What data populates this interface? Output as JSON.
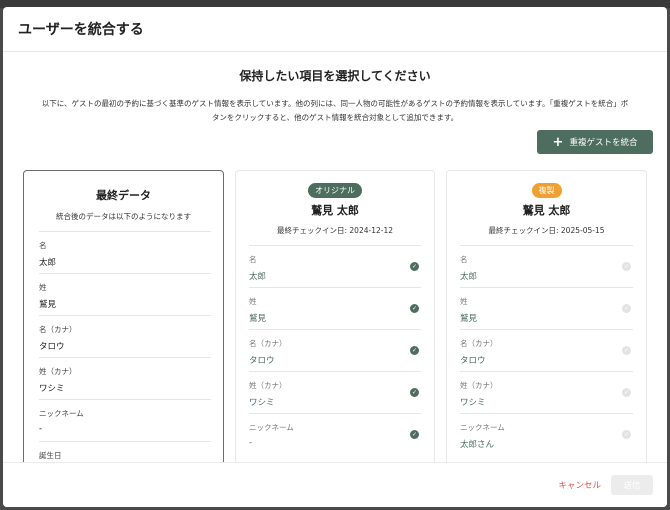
{
  "modal": {
    "title": "ユーザーを統合する"
  },
  "section_title": "保持したい項目を選択してください",
  "description_line1": "以下に、ゲストの最初の予約に基づく基準のゲスト情報を表示しています。他の列には、同一人物の可能性があるゲストの予約情報を表示しています。「重複ゲストを統合」ボ",
  "description_line2": "タンをクリックすると、他のゲスト情報を統合対象として追加できます。",
  "merge_button": {
    "icon": "plus-icon",
    "label": "重複ゲストを統合"
  },
  "final_column": {
    "title": "最終データ",
    "subtitle": "統合後のデータは以下のようになります",
    "fields": [
      {
        "label": "名",
        "value": "太郎"
      },
      {
        "label": "姓",
        "value": "鷲見"
      },
      {
        "label": "名（カナ）",
        "value": "タロウ"
      },
      {
        "label": "姓（カナ）",
        "value": "ワシミ"
      },
      {
        "label": "ニックネーム",
        "value": "-"
      },
      {
        "label": "誕生日",
        "value": ""
      }
    ]
  },
  "original_column": {
    "badge": "オリジナル",
    "badge_color": "#4d6e5f",
    "name": "鷲見 太郎",
    "last_checkin": "最終チェックイン日: 2024-12-12",
    "fields": [
      {
        "label": "名",
        "value": "太郎",
        "selected": true
      },
      {
        "label": "姓",
        "value": "鷲見",
        "selected": true
      },
      {
        "label": "名（カナ）",
        "value": "タロウ",
        "selected": true
      },
      {
        "label": "姓（カナ）",
        "value": "ワシミ",
        "selected": true
      },
      {
        "label": "ニックネーム",
        "value": "-",
        "selected": true
      }
    ]
  },
  "duplicate_column": {
    "badge": "複製",
    "badge_color": "#f0a030",
    "name": "鷲見 太郎",
    "last_checkin": "最終チェックイン日: 2025-05-15",
    "fields": [
      {
        "label": "名",
        "value": "太郎",
        "selected": false
      },
      {
        "label": "姓",
        "value": "鷲見",
        "selected": false
      },
      {
        "label": "名（カナ）",
        "value": "タロウ",
        "selected": false
      },
      {
        "label": "姓（カナ）",
        "value": "ワシミ",
        "selected": false
      },
      {
        "label": "ニックネーム",
        "value": "太郎さん",
        "selected": false
      }
    ]
  },
  "footer": {
    "cancel_label": "キャンセル",
    "submit_label": "送信"
  },
  "colors": {
    "accent": "#4d6e5f",
    "duplicate": "#f0a030",
    "cancel": "#e05050"
  }
}
